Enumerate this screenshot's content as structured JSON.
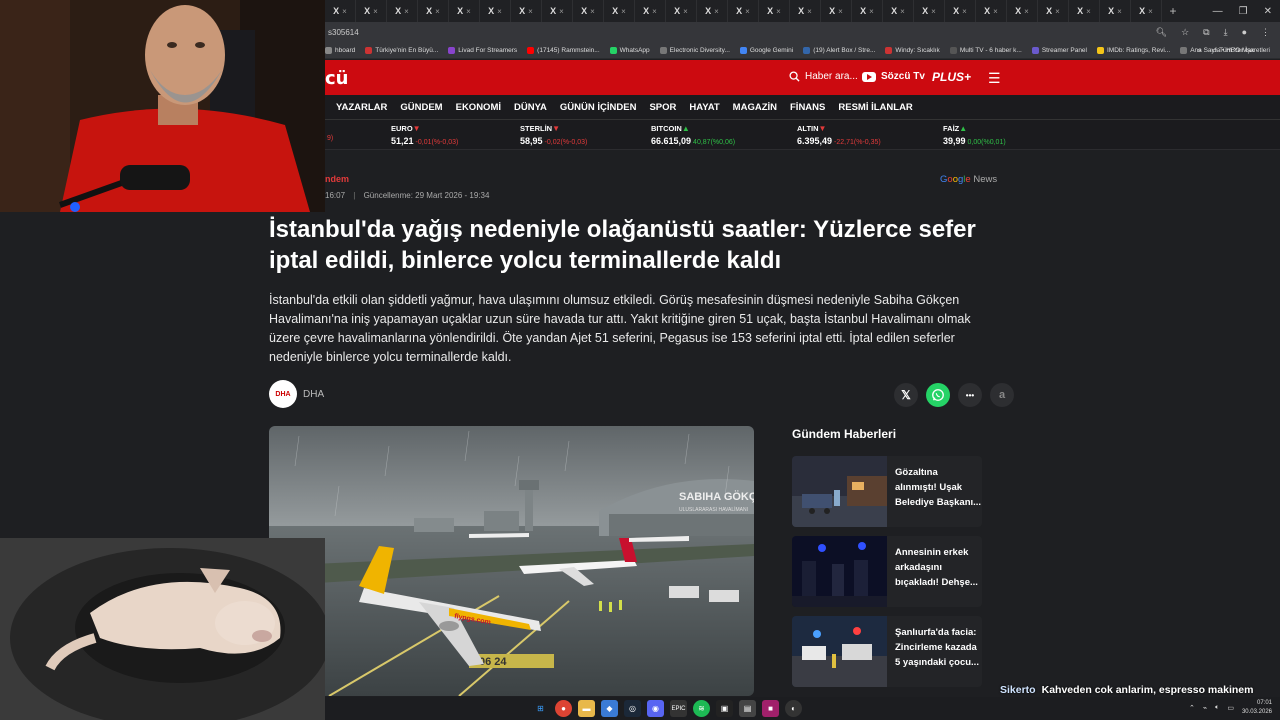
{
  "browser": {
    "tabs_count": 27,
    "tab_glyph": "X",
    "tab_close": "×",
    "url_fragment": "s305614",
    "bookmarks": [
      {
        "label": "hboard",
        "color": "#888"
      },
      {
        "label": "Türkiye'nin En Büyü...",
        "color": "#cc3333"
      },
      {
        "label": "Livad For Streamers",
        "color": "#8844cc"
      },
      {
        "label": "(17145) Rammstein...",
        "color": "#ff0000"
      },
      {
        "label": "WhatsApp",
        "color": "#25d366"
      },
      {
        "label": "Electronic Diversity...",
        "color": "#777"
      },
      {
        "label": "Google Gemini",
        "color": "#4285f4"
      },
      {
        "label": "(19) Alert Box / Stre...",
        "color": "#36a"
      },
      {
        "label": "Windy: Sıcaklık",
        "color": "#c33"
      },
      {
        "label": "Multi TV - 6 haber k...",
        "color": "#555"
      },
      {
        "label": "Streamer Panel",
        "color": "#6a5acd"
      },
      {
        "label": "IMDb: Ratings, Revi...",
        "color": "#f5c518"
      },
      {
        "label": "Ana Sayfa • HBO Max",
        "color": "#777"
      }
    ],
    "bookmarks_more": "»",
    "bookmarks_all": "Tüm Yer İşaretleri"
  },
  "site": {
    "logo": "cü",
    "search_placeholder": "Haber ara...",
    "tv_label": "Sözcü Tv",
    "plus_label": "PLUS+",
    "nav": [
      "YAZARLAR",
      "GÜNDEM",
      "EKONOMİ",
      "DÜNYA",
      "GÜNÜN İÇİNDEN",
      "SPOR",
      "HAYAT",
      "MAGAZİN",
      "FİNANS",
      "RESMİ İLANLAR"
    ],
    "ticker_edge": "9)",
    "ticker": [
      {
        "name": "EURO",
        "trend": "down",
        "value": "51,21",
        "change": "-0,01(%-0,03)"
      },
      {
        "name": "STERLİN",
        "trend": "down",
        "value": "58,95",
        "change": "-0,02(%-0,03)"
      },
      {
        "name": "BITCOIN",
        "trend": "up",
        "value": "66.615,09",
        "change": "40,87(%0,06)"
      },
      {
        "name": "ALTIN",
        "trend": "down",
        "value": "6.395,49",
        "change": "-22,71(%-0,35)"
      },
      {
        "name": "FAİZ",
        "trend": "up",
        "value": "39,99",
        "change": "0,00(%0,01)"
      }
    ]
  },
  "article": {
    "category": "ndem",
    "published": "16:07",
    "updated": "Güncellenme: 29 Mart 2026 - 19:34",
    "google_news": "News",
    "headline": "İstanbul'da yağış nedeniyle olağanüstü saatler: Yüzlerce sefer iptal edildi, binlerce yolcu terminallerde kaldı",
    "summary": "İstanbul'da etkili olan şiddetli yağmur, hava ulaşımını olumsuz etkiledi. Görüş mesafesinin düşmesi nedeniyle Sabiha Gökçen Havalimanı'na iniş yapamayan uçaklar uzun süre havada tur attı. Yakıt kritiğine giren 51 uçak, başta İstanbul Havalimanı olmak üzere çevre havalimanlarına yönlendirildi. Öte yandan Ajet 51 seferini, Pegasus ise 153 seferini iptal etti. İptal edilen seferler nedeniyle binlerce yolcu terminallerde kaldı.",
    "source_logo": "DHA",
    "source_name": "DHA",
    "share": {
      "x": "𝕏",
      "more": "•••",
      "font": "a"
    },
    "image_caption_sign": "SABIHA GÖKÇEN",
    "image_caption_sign2": "ULUSLARARASI HAVALİMANI",
    "image_plane_text": "flypgs.com",
    "image_runway": "06  24"
  },
  "sidebar": {
    "title": "Gündem Haberleri",
    "items": [
      {
        "text": "Gözaltına alınmıştı! Uşak Belediye Başkanı..."
      },
      {
        "text": "Annesinin erkek arkadaşını bıçakladı! Dehşe..."
      },
      {
        "text": "Şanlıurfa'da facia: Zincirleme kazada 5 yaşındaki çocu..."
      }
    ]
  },
  "chat": {
    "user": "Sikerto",
    "message": "Kahveden cok anlarim, espresso makinem falan var. Bu adam hakli"
  },
  "taskbar": {
    "time": "07:01",
    "date": "30.03.2026"
  }
}
